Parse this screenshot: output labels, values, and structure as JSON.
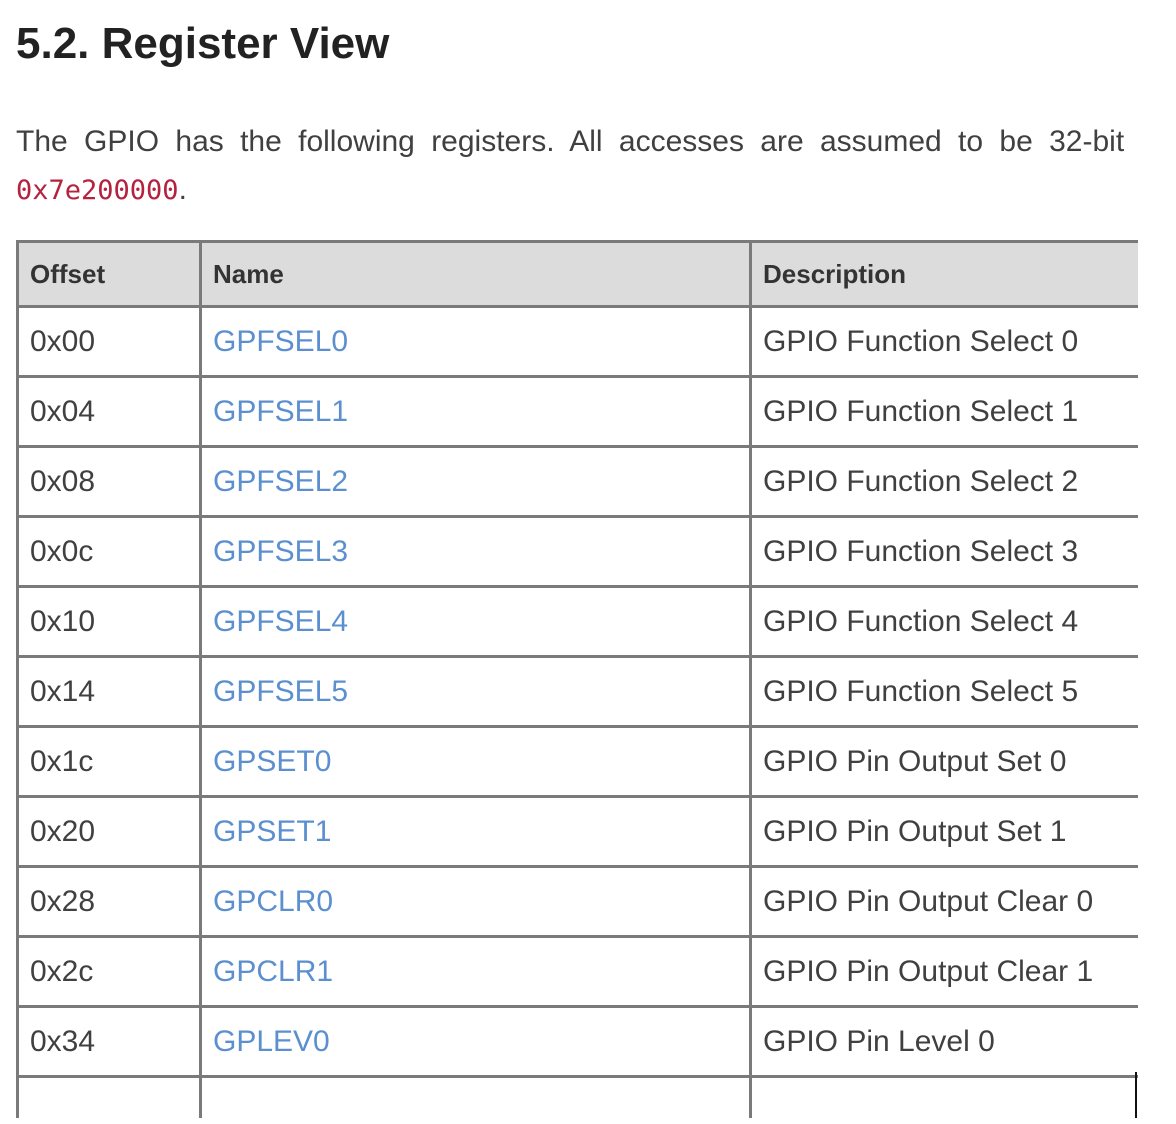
{
  "section": {
    "title": "5.2. Register View"
  },
  "intro": {
    "text_line1": "The GPIO has the following registers. All accesses are assumed to be 32-bit",
    "base_address": "0x7e200000",
    "text_line2_end": "."
  },
  "table": {
    "headers": {
      "offset": "Offset",
      "name": "Name",
      "description": "Description"
    },
    "rows": [
      {
        "offset": "0x00",
        "name": "GPFSEL0",
        "description": "GPIO Function Select 0"
      },
      {
        "offset": "0x04",
        "name": "GPFSEL1",
        "description": "GPIO Function Select 1"
      },
      {
        "offset": "0x08",
        "name": "GPFSEL2",
        "description": "GPIO Function Select 2"
      },
      {
        "offset": "0x0c",
        "name": "GPFSEL3",
        "description": "GPIO Function Select 3"
      },
      {
        "offset": "0x10",
        "name": "GPFSEL4",
        "description": "GPIO Function Select 4"
      },
      {
        "offset": "0x14",
        "name": "GPFSEL5",
        "description": "GPIO Function Select 5"
      },
      {
        "offset": "0x1c",
        "name": "GPSET0",
        "description": "GPIO Pin Output Set 0"
      },
      {
        "offset": "0x20",
        "name": "GPSET1",
        "description": "GPIO Pin Output Set 1"
      },
      {
        "offset": "0x28",
        "name": "GPCLR0",
        "description": "GPIO Pin Output Clear 0"
      },
      {
        "offset": "0x2c",
        "name": "GPCLR1",
        "description": "GPIO Pin Output Clear 1"
      },
      {
        "offset": "0x34",
        "name": "GPLEV0",
        "description": "GPIO Pin Level 0"
      },
      {
        "offset": "",
        "name": "",
        "description": ""
      }
    ]
  },
  "colors": {
    "link": "#5b8fcf",
    "code": "#b5223f",
    "header_bg": "#dcdcdc",
    "border": "#7a7a7a"
  }
}
